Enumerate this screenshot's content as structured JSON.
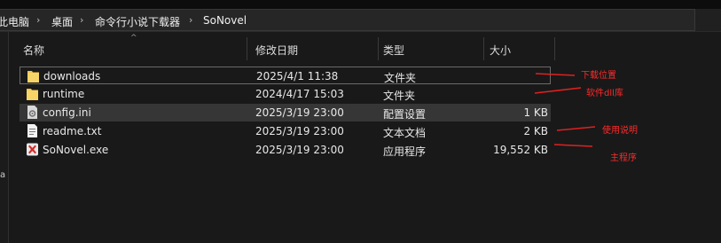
{
  "breadcrumb": {
    "items": [
      "此电脑",
      "桌面",
      "命令行小说下载器",
      "SoNovel"
    ]
  },
  "columns": {
    "name": "名称",
    "modified": "修改日期",
    "type": "类型",
    "size": "大小"
  },
  "files": [
    {
      "name": "downloads",
      "modified": "2025/4/1 11:38",
      "type": "文件夹",
      "size": "",
      "icon": "folder-icon"
    },
    {
      "name": "runtime",
      "modified": "2024/4/17 15:03",
      "type": "文件夹",
      "size": "",
      "icon": "folder-icon"
    },
    {
      "name": "config.ini",
      "modified": "2025/3/19 23:00",
      "type": "配置设置",
      "size": "1 KB",
      "icon": "settings-file-icon"
    },
    {
      "name": "readme.txt",
      "modified": "2025/3/19 23:00",
      "type": "文本文档",
      "size": "2 KB",
      "icon": "text-file-icon"
    },
    {
      "name": "SoNovel.exe",
      "modified": "2025/3/19 23:00",
      "type": "应用程序",
      "size": "19,552 KB",
      "icon": "exe-icon"
    }
  ],
  "annotations": [
    "下载位置",
    "软件dll库",
    "使用说明",
    "主程序"
  ],
  "left_pane_cut_text": "a",
  "colors": {
    "annotation": "#ff2a2a",
    "folder": "#f2c64c",
    "selection": "#363636"
  }
}
